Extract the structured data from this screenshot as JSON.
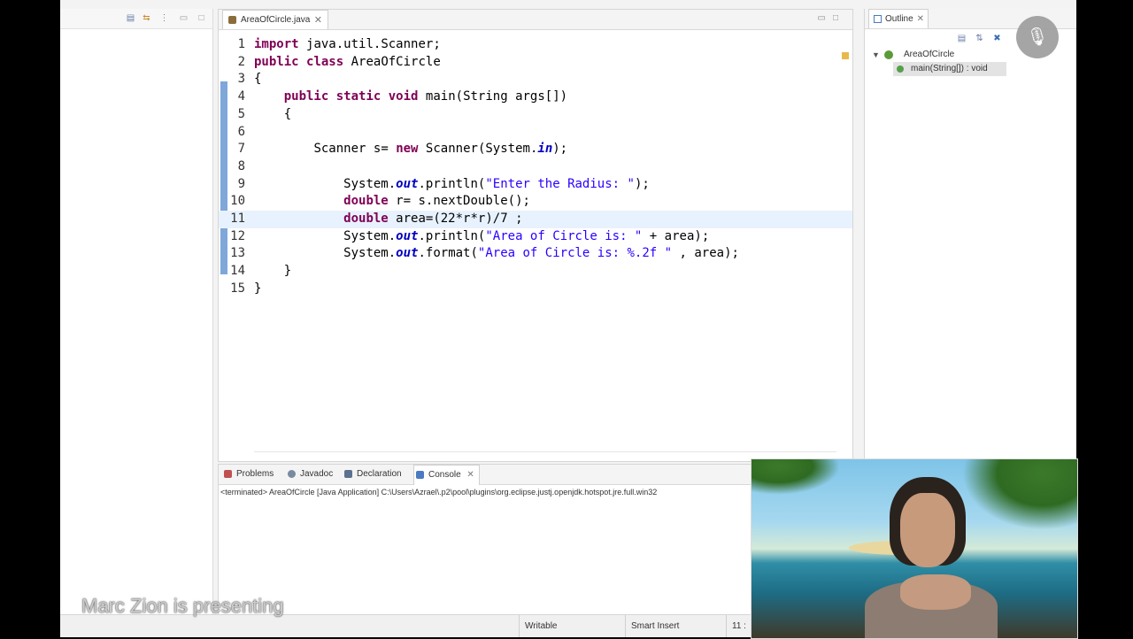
{
  "editor": {
    "tab_title": "AreaOfCircle.java",
    "lines": [
      {
        "n": "1",
        "code": "import java.util.Scanner;"
      },
      {
        "n": "2",
        "code": "public class AreaOfCircle"
      },
      {
        "n": "3",
        "code": "{"
      },
      {
        "n": "4",
        "code": "    public static void main(String args[])"
      },
      {
        "n": "5",
        "code": "    {"
      },
      {
        "n": "6",
        "code": ""
      },
      {
        "n": "7",
        "code": "        Scanner s= new Scanner(System.in);"
      },
      {
        "n": "8",
        "code": ""
      },
      {
        "n": "9",
        "code": "            System.out.println(\"Enter the Radius: \");"
      },
      {
        "n": "10",
        "code": "            double r= s.nextDouble();"
      },
      {
        "n": "11",
        "code": "            double area=(22*r*r)/7 ;"
      },
      {
        "n": "12",
        "code": "            System.out.println(\"Area of Circle is: \" + area);"
      },
      {
        "n": "13",
        "code": "            System.out.format(\"Area of Circle is: %.2f \" , area);"
      },
      {
        "n": "14",
        "code": "    }"
      },
      {
        "n": "15",
        "code": "}"
      }
    ],
    "current_line": "11"
  },
  "outline": {
    "tab_label": "Outline",
    "class_name": "AreaOfCircle",
    "method": "main(String[]) : void"
  },
  "bottom": {
    "tabs": [
      "Problems",
      "Javadoc",
      "Declaration",
      "Console"
    ],
    "active_tab": "Console",
    "terminated_line": "<terminated> AreaOfCircle [Java Application] C:\\Users\\Azrael\\.p2\\pool\\plugins\\org.eclipse.justj.openjdk.hotspot.jre.full.win32"
  },
  "status": {
    "writable": "Writable",
    "insert_mode": "Smart Insert",
    "position": "11 :"
  },
  "overlay": {
    "presenting_text": "Marc Zion is presenting",
    "mic_icon": "mic-muted-icon"
  }
}
